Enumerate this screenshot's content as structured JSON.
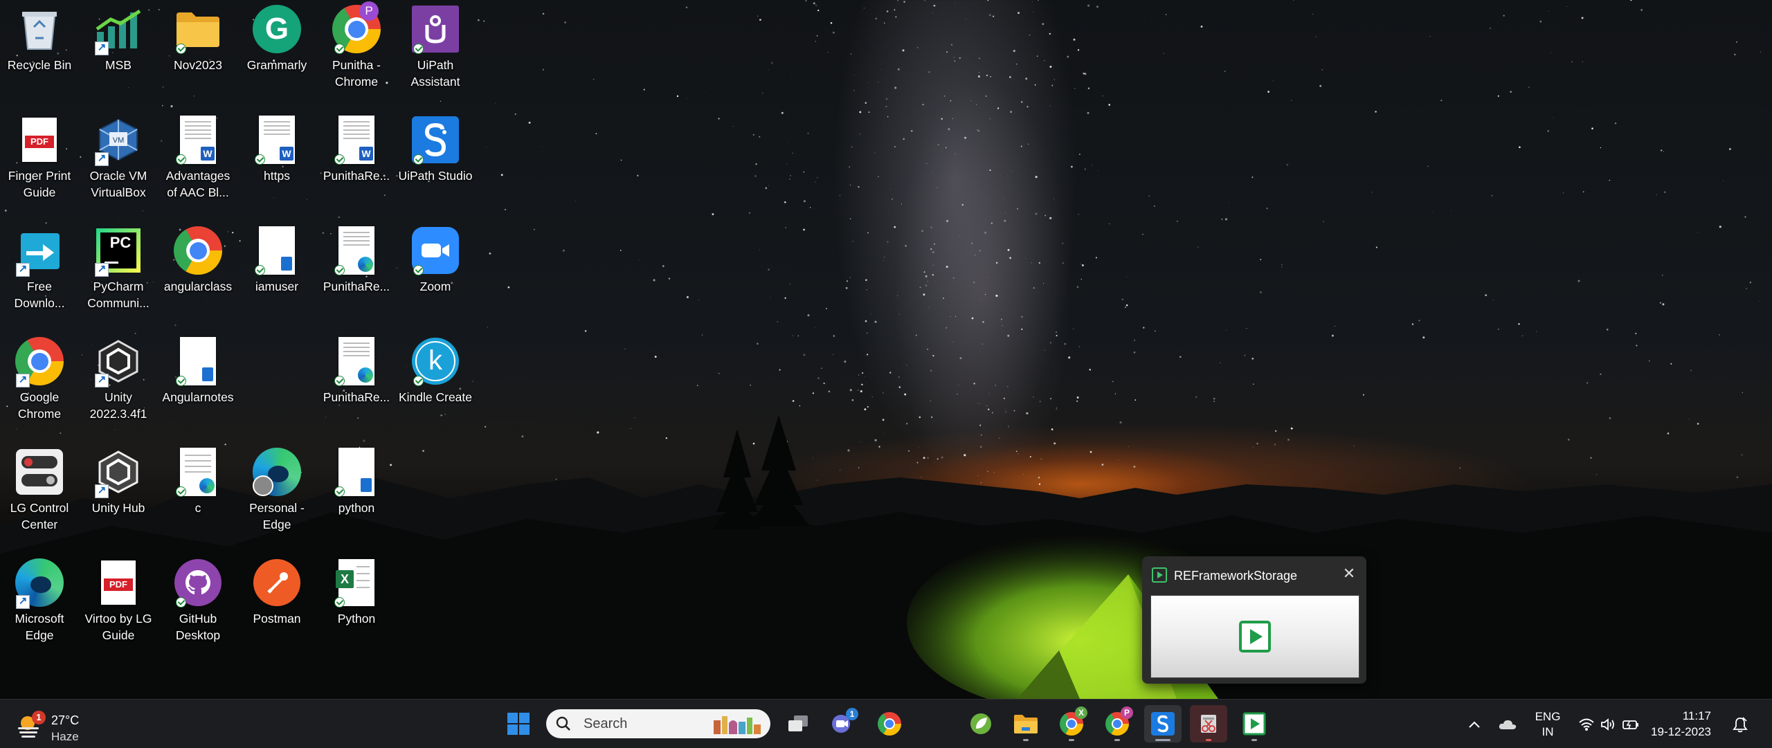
{
  "desktop": {
    "icons": [
      {
        "label": "Recycle Bin",
        "icon": "recycle-bin-icon"
      },
      {
        "label": "MSB",
        "icon": "msb-chart-icon"
      },
      {
        "label": "Nov2023",
        "icon": "folder-icon"
      },
      {
        "label": "Grammarly",
        "icon": "grammarly-icon"
      },
      {
        "label": "Punitha -\nChrome",
        "icon": "chrome-profile-icon",
        "profile_letter": "P"
      },
      {
        "label": "UiPath\nAssistant",
        "icon": "uipath-assistant-icon"
      },
      {
        "label": "Finger Print\nGuide",
        "icon": "pdf-icon",
        "badge_text": "PDF"
      },
      {
        "label": "Oracle VM\nVirtualBox",
        "icon": "virtualbox-icon"
      },
      {
        "label": "Advantages\nof AAC Bl...",
        "icon": "word-doc-icon",
        "badge_text": "W"
      },
      {
        "label": "https",
        "icon": "word-doc-icon",
        "badge_text": "W"
      },
      {
        "label": "PunithaRe...",
        "icon": "word-doc-icon",
        "badge_text": "W"
      },
      {
        "label": "UiPath Studio",
        "icon": "uipath-studio-icon"
      },
      {
        "label": "Free\nDownlo...",
        "icon": "free-download-icon"
      },
      {
        "label": "PyCharm\nCommuni...",
        "icon": "pycharm-icon",
        "badge_text": "PC"
      },
      {
        "label": "angularclass",
        "icon": "chrome-icon"
      },
      {
        "label": "iamuser",
        "icon": "text-doc-icon"
      },
      {
        "label": "PunithaRe...",
        "icon": "edge-doc-icon"
      },
      {
        "label": "Zoom",
        "icon": "zoom-icon"
      },
      {
        "label": "Google\nChrome",
        "icon": "chrome-icon"
      },
      {
        "label": "Unity\n2022.3.4f1",
        "icon": "unity-icon"
      },
      {
        "label": "Angularnotes",
        "icon": "text-doc-icon"
      },
      {
        "label": "PunithaRe...",
        "icon": "edge-doc-icon"
      },
      {
        "label": "Kindle Create",
        "icon": "kindle-create-icon",
        "badge_text": "k"
      },
      {
        "label": "LG Control\nCenter",
        "icon": "lg-control-center-icon"
      },
      {
        "label": "Unity Hub",
        "icon": "unity-hub-icon"
      },
      {
        "label": "c",
        "icon": "edge-doc-icon"
      },
      {
        "label": "Personal -\nEdge",
        "icon": "edge-profile-icon"
      },
      {
        "label": "python",
        "icon": "text-doc-icon"
      },
      {
        "label": "Microsoft\nEdge",
        "icon": "edge-icon"
      },
      {
        "label": "Virtoo by LG\nGuide",
        "icon": "pdf-icon",
        "badge_text": "PDF"
      },
      {
        "label": "GitHub\nDesktop",
        "icon": "github-icon"
      },
      {
        "label": "Postman",
        "icon": "postman-icon"
      },
      {
        "label": "Python",
        "icon": "excel-icon",
        "badge_text": "X"
      }
    ]
  },
  "toast": {
    "title": "REFrameworkStorage",
    "close_icon": "close-icon"
  },
  "taskbar": {
    "weather": {
      "temp": "27°C",
      "condition": "Haze",
      "badge": "1"
    },
    "search_placeholder": "Search",
    "meet_badge": "1",
    "chrome_x_badge": "X",
    "chrome_p_badge": "P",
    "lang_line1": "ENG",
    "lang_line2": "IN",
    "time": "11:17",
    "date": "19-12-2023"
  },
  "colors": {
    "taskbar_bg": "#1c1d21",
    "toast_bg": "#2b2b2b",
    "uipath_orange": "#fa4616",
    "start_blue": "#2f8fe8"
  }
}
